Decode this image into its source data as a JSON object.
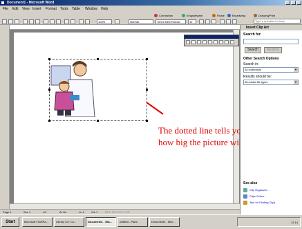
{
  "window": {
    "title": "Document1 - Microsoft Word"
  },
  "menu": [
    "File",
    "Edit",
    "View",
    "Insert",
    "Format",
    "Tools",
    "Table",
    "Window",
    "Help"
  ],
  "toolbar": {
    "zoom": "100%",
    "style": "Normal",
    "font": "Times New Roman",
    "size": "12",
    "extras": [
      "Connection",
      "Kingsoftware",
      "Finale",
      "Broadwing",
      "Drawing/Print"
    ],
    "help_placeholder": "Type a question for help"
  },
  "picture_toolbar": {
    "title": "Picture"
  },
  "task_pane": {
    "title": "Insert Clip Art",
    "search_for_label": "Search for:",
    "search_button": "Search",
    "restore_button": "Restore",
    "other_options_label": "Other Search Options",
    "search_in_label": "Search in:",
    "search_in_value": "All collections",
    "results_label": "Results should be:",
    "results_value": "All media file types",
    "see_also_label": "See also",
    "links": [
      "Clip Organizer...",
      "Clips Online",
      "Tips for Finding Clips"
    ]
  },
  "annotation": {
    "line1": "The dotted line tells you",
    "line2": "how big the picture will be."
  },
  "status": {
    "page": "Page 1",
    "sec": "Sec 1",
    "pages": "1/1",
    "at": "At 1in",
    "ln": "Ln 1",
    "col": "Col 1",
    "modes": "REC  TRK  EXT  OVR"
  },
  "taskbar": {
    "start": "Start",
    "tasks": [
      "Microsoft FrontPa...",
      "Library ICT Co...",
      "Document1 - Mic...",
      "untitled - Paint",
      "Document2 - Micr..."
    ],
    "active_index": 2,
    "clock": "12:14"
  },
  "colors": {
    "annotation": "#e00000",
    "titlebar": "#0a246a",
    "chrome": "#d4d0c8"
  }
}
